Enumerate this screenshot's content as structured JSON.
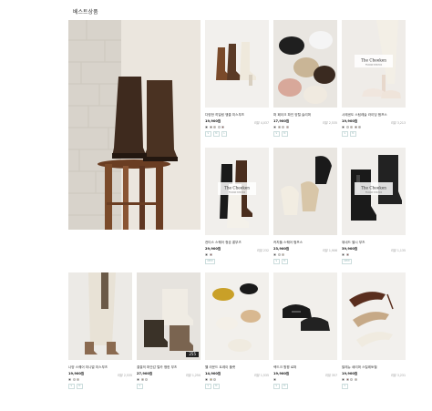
{
  "section_title": "베스트상품",
  "brand_overlay": {
    "name": "The Cheeken",
    "sub": "Premium Collection"
  },
  "products": [
    {
      "name": "다양한 히일링 앵클 미스부츠",
      "price": "19,900원",
      "review": "리뷰 4,037",
      "swatches": [
        "#1a1a1a",
        "#6b4a32",
        "#c6a987",
        "#e8e3d8",
        "#8a2d2a"
      ],
      "badges": [
        "S",
        "M",
        "L"
      ]
    },
    {
      "name": "퍼 페이크 파인 양털 슬리퍼",
      "price": "17,900원",
      "review": "리뷰 2,535",
      "swatches": [
        "#1a1a1a",
        "#a08060",
        "#d8c8b0",
        "#c98a7a"
      ],
      "badges": [
        "S",
        "M"
      ]
    },
    {
      "name": "시에센도 스팀레슬 라이딩 펌프스",
      "price": "19,900원",
      "review": "리뷰 3,213",
      "swatches": [
        "#1a1a1a",
        "#e8e3d8",
        "#c6a987",
        "#7a5034",
        "#bfa78c"
      ],
      "badges": [
        "S",
        "M"
      ]
    },
    {
      "name": "컨티스 스퀘어 청곰 롱부츠",
      "price": "29,900원",
      "review": "리뷰 232",
      "swatches": [
        "#1a1a1a",
        "#8a2d2a"
      ],
      "badges": [
        "NEW"
      ]
    },
    {
      "name": "커치뜰 스퀘어 펌프스",
      "price": "23,900원",
      "review": "리뷰 1,906",
      "swatches": [
        "#1a1a1a",
        "#e8e3d8",
        "#c6a987"
      ],
      "badges": [
        "S",
        "M"
      ]
    },
    {
      "name": "위네드 첼시 부츠",
      "price": "39,900원",
      "review": "리뷰 1,135",
      "swatches": [
        "#1a1a1a",
        "#8a2d2a"
      ],
      "badges": [
        "NEW"
      ]
    },
    {
      "name": "나양 스퀘어 미니멀 미스부츠",
      "price": "19,900원",
      "review": "리뷰 2,535",
      "swatches": [
        "#1a1a1a",
        "#e8e3d8",
        "#c6a987"
      ],
      "badges": [
        "S",
        "M"
      ]
    },
    {
      "name": "결결의 퍼안감 털카 앵헌 부츠",
      "price": "27,900원",
      "review": "리뷰 1,250",
      "swatches": [
        "#1a1a1a",
        "#a08060",
        "#e8e3d8"
      ],
      "badges": [
        "S"
      ]
    },
    {
      "name": "웰 라운드 트레이 플랫",
      "price": "14,900원",
      "review": "리뷰 1,535",
      "swatches": [
        "#1a1a1a",
        "#c9a028",
        "#e8e3d8"
      ],
      "badges": [
        "S",
        "M"
      ]
    },
    {
      "name": "렉드크 윙윙 로퍼",
      "price": "19,900원",
      "review": "리뷰 357",
      "swatches": [
        "#1a1a1a"
      ],
      "badges": [
        "S",
        "M"
      ]
    },
    {
      "name": "발레뉴 쇄리퍼 스틸레토힐",
      "price": "19,900원",
      "review": "리뷰 3,231",
      "swatches": [
        "#1a1a1a",
        "#8a2d2a",
        "#e8e3d8",
        "#c6a987"
      ],
      "badges": [
        "S"
      ]
    }
  ],
  "image_count_badge": "255"
}
